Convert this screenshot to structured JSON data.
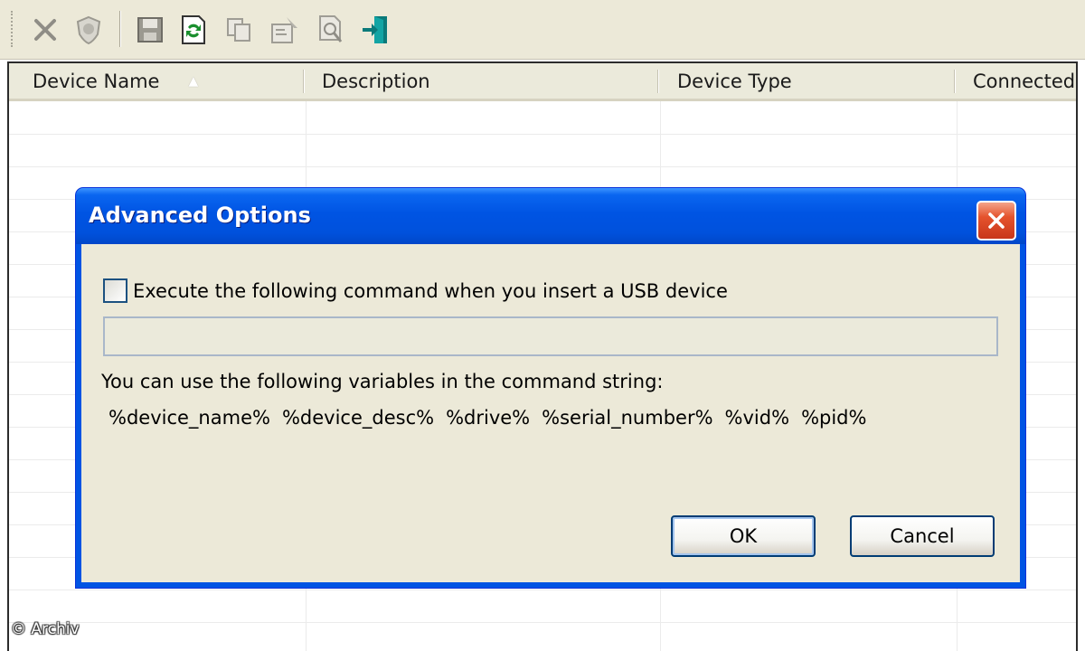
{
  "toolbar": {
    "buttons": [
      {
        "icon": "delete-x-icon"
      },
      {
        "icon": "shield-icon"
      },
      {
        "icon": "save-icon"
      },
      {
        "icon": "refresh-icon"
      },
      {
        "icon": "copy-icon"
      },
      {
        "icon": "properties-icon"
      },
      {
        "icon": "find-icon"
      },
      {
        "icon": "exit-icon"
      }
    ]
  },
  "list": {
    "columns": [
      "Device Name",
      "Description",
      "Device Type",
      "Connected"
    ],
    "sorted_column": "Device Name",
    "sort_direction": "ascending"
  },
  "dialog": {
    "title": "Advanced Options",
    "checkbox_label": "Execute the following command when you insert a USB device",
    "checkbox_checked": false,
    "command_value": "",
    "vars_intro": "You can use the following variables in the command string:",
    "variables": [
      "%device_name%",
      "%device_desc%",
      "%drive%",
      "%serial_number%",
      "%vid%",
      "%pid%"
    ],
    "ok_label": "OK",
    "cancel_label": "Cancel"
  },
  "watermark": "© Archiv",
  "colors": {
    "titlebar": "#0054e3",
    "dialog_face": "#ece9d8",
    "close_button": "#e5532d"
  }
}
